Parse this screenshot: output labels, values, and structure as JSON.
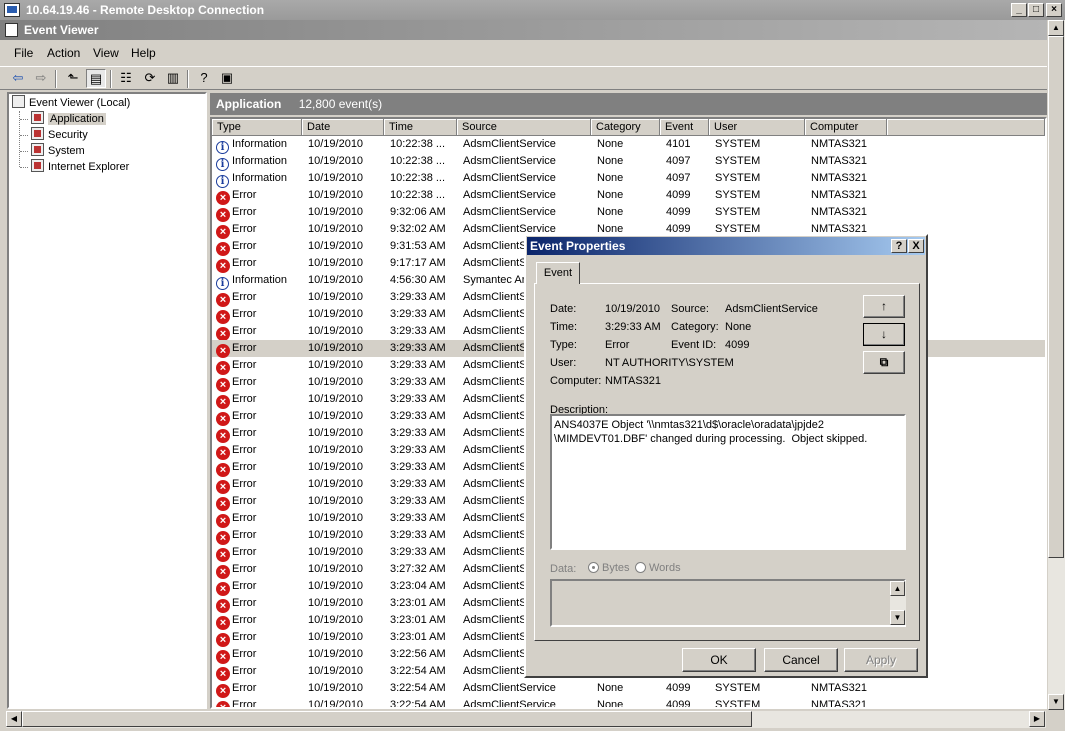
{
  "rdp_window": {
    "title": "10.64.19.46 - Remote Desktop Connection"
  },
  "app_window": {
    "title": "Event Viewer"
  },
  "menu": [
    "File",
    "Action",
    "View",
    "Help"
  ],
  "tree": {
    "root": "Event Viewer (Local)",
    "logs": [
      "Application",
      "Security",
      "System",
      "Internet Explorer"
    ],
    "selected": "Application"
  },
  "list": {
    "title": "Application",
    "count": "12,800 event(s)",
    "columns": [
      "Type",
      "Date",
      "Time",
      "Source",
      "Category",
      "Event",
      "User",
      "Computer"
    ],
    "rows": [
      {
        "type": "Information",
        "date": "10/19/2010",
        "time": "10:22:38 ...",
        "source": "AdsmClientService",
        "category": "None",
        "event": "4101",
        "user": "SYSTEM",
        "computer": "NMTAS321"
      },
      {
        "type": "Information",
        "date": "10/19/2010",
        "time": "10:22:38 ...",
        "source": "AdsmClientService",
        "category": "None",
        "event": "4097",
        "user": "SYSTEM",
        "computer": "NMTAS321"
      },
      {
        "type": "Information",
        "date": "10/19/2010",
        "time": "10:22:38 ...",
        "source": "AdsmClientService",
        "category": "None",
        "event": "4097",
        "user": "SYSTEM",
        "computer": "NMTAS321"
      },
      {
        "type": "Error",
        "date": "10/19/2010",
        "time": "10:22:38 ...",
        "source": "AdsmClientService",
        "category": "None",
        "event": "4099",
        "user": "SYSTEM",
        "computer": "NMTAS321"
      },
      {
        "type": "Error",
        "date": "10/19/2010",
        "time": "9:32:06 AM",
        "source": "AdsmClientService",
        "category": "None",
        "event": "4099",
        "user": "SYSTEM",
        "computer": "NMTAS321"
      },
      {
        "type": "Error",
        "date": "10/19/2010",
        "time": "9:32:02 AM",
        "source": "AdsmClientService",
        "category": "None",
        "event": "4099",
        "user": "SYSTEM",
        "computer": "NMTAS321"
      },
      {
        "type": "Error",
        "date": "10/19/2010",
        "time": "9:31:53 AM",
        "source": "AdsmClientSe",
        "category": "",
        "event": "",
        "user": "",
        "computer": ""
      },
      {
        "type": "Error",
        "date": "10/19/2010",
        "time": "9:17:17 AM",
        "source": "AdsmClientSe",
        "category": "",
        "event": "",
        "user": "",
        "computer": ""
      },
      {
        "type": "Information",
        "date": "10/19/2010",
        "time": "4:56:30 AM",
        "source": "Symantec An",
        "category": "",
        "event": "",
        "user": "",
        "computer": ""
      },
      {
        "type": "Error",
        "date": "10/19/2010",
        "time": "3:29:33 AM",
        "source": "AdsmClientSe",
        "category": "",
        "event": "",
        "user": "",
        "computer": ""
      },
      {
        "type": "Error",
        "date": "10/19/2010",
        "time": "3:29:33 AM",
        "source": "AdsmClientSe",
        "category": "",
        "event": "",
        "user": "",
        "computer": ""
      },
      {
        "type": "Error",
        "date": "10/19/2010",
        "time": "3:29:33 AM",
        "source": "AdsmClientSe",
        "category": "",
        "event": "",
        "user": "",
        "computer": ""
      },
      {
        "type": "Error",
        "date": "10/19/2010",
        "time": "3:29:33 AM",
        "source": "AdsmClientSe",
        "category": "",
        "event": "",
        "user": "",
        "computer": "",
        "selected": true
      },
      {
        "type": "Error",
        "date": "10/19/2010",
        "time": "3:29:33 AM",
        "source": "AdsmClientSe",
        "category": "",
        "event": "",
        "user": "",
        "computer": ""
      },
      {
        "type": "Error",
        "date": "10/19/2010",
        "time": "3:29:33 AM",
        "source": "AdsmClientSe",
        "category": "",
        "event": "",
        "user": "",
        "computer": ""
      },
      {
        "type": "Error",
        "date": "10/19/2010",
        "time": "3:29:33 AM",
        "source": "AdsmClientSe",
        "category": "",
        "event": "",
        "user": "",
        "computer": ""
      },
      {
        "type": "Error",
        "date": "10/19/2010",
        "time": "3:29:33 AM",
        "source": "AdsmClientSe",
        "category": "",
        "event": "",
        "user": "",
        "computer": ""
      },
      {
        "type": "Error",
        "date": "10/19/2010",
        "time": "3:29:33 AM",
        "source": "AdsmClientSe",
        "category": "",
        "event": "",
        "user": "",
        "computer": ""
      },
      {
        "type": "Error",
        "date": "10/19/2010",
        "time": "3:29:33 AM",
        "source": "AdsmClientSe",
        "category": "",
        "event": "",
        "user": "",
        "computer": ""
      },
      {
        "type": "Error",
        "date": "10/19/2010",
        "time": "3:29:33 AM",
        "source": "AdsmClientSe",
        "category": "",
        "event": "",
        "user": "",
        "computer": ""
      },
      {
        "type": "Error",
        "date": "10/19/2010",
        "time": "3:29:33 AM",
        "source": "AdsmClientSe",
        "category": "",
        "event": "",
        "user": "",
        "computer": ""
      },
      {
        "type": "Error",
        "date": "10/19/2010",
        "time": "3:29:33 AM",
        "source": "AdsmClientSe",
        "category": "",
        "event": "",
        "user": "",
        "computer": ""
      },
      {
        "type": "Error",
        "date": "10/19/2010",
        "time": "3:29:33 AM",
        "source": "AdsmClientSe",
        "category": "",
        "event": "",
        "user": "",
        "computer": ""
      },
      {
        "type": "Error",
        "date": "10/19/2010",
        "time": "3:29:33 AM",
        "source": "AdsmClientSe",
        "category": "",
        "event": "",
        "user": "",
        "computer": ""
      },
      {
        "type": "Error",
        "date": "10/19/2010",
        "time": "3:29:33 AM",
        "source": "AdsmClientSe",
        "category": "",
        "event": "",
        "user": "",
        "computer": ""
      },
      {
        "type": "Error",
        "date": "10/19/2010",
        "time": "3:27:32 AM",
        "source": "AdsmClientSe",
        "category": "",
        "event": "",
        "user": "",
        "computer": ""
      },
      {
        "type": "Error",
        "date": "10/19/2010",
        "time": "3:23:04 AM",
        "source": "AdsmClientSe",
        "category": "",
        "event": "",
        "user": "",
        "computer": ""
      },
      {
        "type": "Error",
        "date": "10/19/2010",
        "time": "3:23:01 AM",
        "source": "AdsmClientSe",
        "category": "",
        "event": "",
        "user": "",
        "computer": ""
      },
      {
        "type": "Error",
        "date": "10/19/2010",
        "time": "3:23:01 AM",
        "source": "AdsmClientSe",
        "category": "",
        "event": "",
        "user": "",
        "computer": ""
      },
      {
        "type": "Error",
        "date": "10/19/2010",
        "time": "3:23:01 AM",
        "source": "AdsmClientSe",
        "category": "",
        "event": "",
        "user": "",
        "computer": ""
      },
      {
        "type": "Error",
        "date": "10/19/2010",
        "time": "3:22:56 AM",
        "source": "AdsmClientSe",
        "category": "",
        "event": "",
        "user": "",
        "computer": ""
      },
      {
        "type": "Error",
        "date": "10/19/2010",
        "time": "3:22:54 AM",
        "source": "AdsmClientSe",
        "category": "",
        "event": "",
        "user": "",
        "computer": ""
      },
      {
        "type": "Error",
        "date": "10/19/2010",
        "time": "3:22:54 AM",
        "source": "AdsmClientService",
        "category": "None",
        "event": "4099",
        "user": "SYSTEM",
        "computer": "NMTAS321"
      },
      {
        "type": "Error",
        "date": "10/19/2010",
        "time": "3:22:54 AM",
        "source": "AdsmClientService",
        "category": "None",
        "event": "4099",
        "user": "SYSTEM",
        "computer": "NMTAS321"
      }
    ]
  },
  "dialog": {
    "title": "Event Properties",
    "tab": "Event",
    "date_label": "Date:",
    "date": "10/19/2010",
    "source_label": "Source:",
    "source": "AdsmClientService",
    "time_label": "Time:",
    "time": "3:29:33 AM",
    "category_label": "Category:",
    "category": "None",
    "type_label": "Type:",
    "type": "Error",
    "eventid_label": "Event ID:",
    "eventid": "4099",
    "user_label": "User:",
    "user": "NT AUTHORITY\\SYSTEM",
    "computer_label": "Computer:",
    "computer": "NMTAS321",
    "description_label": "Description:",
    "description": "ANS4037E Object '\\\\nmtas321\\d$\\oracle\\oradata\\jpjde2\n\\MIMDEVT01.DBF' changed during processing.  Object skipped.",
    "data_label": "Data:",
    "bytes_label": "Bytes",
    "words_label": "Words",
    "ok": "OK",
    "cancel": "Cancel",
    "apply": "Apply",
    "help_glyph": "?",
    "close_glyph": "X",
    "up_glyph": "↑",
    "down_glyph": "↓",
    "copy_glyph": "⧉"
  }
}
